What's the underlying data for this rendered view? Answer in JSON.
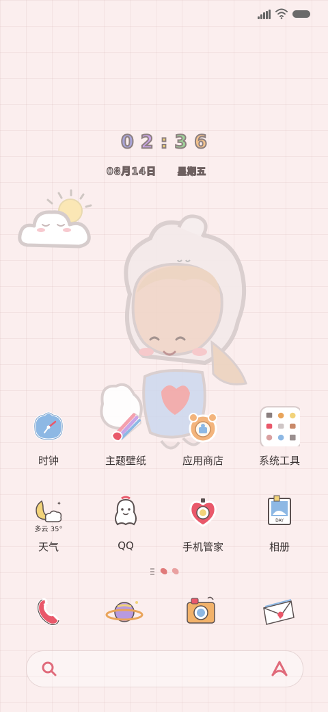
{
  "status_bar": {
    "icons": [
      "signal-icon",
      "wifi-icon",
      "battery-icon"
    ]
  },
  "clock_widget": {
    "digits": [
      {
        "char": "0",
        "color": "#a9a4d8"
      },
      {
        "char": "2",
        "color": "#c9a4e6"
      },
      {
        "char": ":",
        "color": "#f2d37a"
      },
      {
        "char": "3",
        "color": "#9fd49a"
      },
      {
        "char": "6",
        "color": "#f3c28c"
      }
    ],
    "date": "08月14日",
    "weekday": "星期五"
  },
  "apps": [
    {
      "label": "时钟",
      "icon": "clock-icon"
    },
    {
      "label": "主题壁纸",
      "icon": "theme-wallpaper-icon"
    },
    {
      "label": "应用商店",
      "icon": "app-store-icon"
    },
    {
      "label": "系统工具",
      "icon": "system-tools-folder-icon"
    },
    {
      "label": "天气",
      "icon": "weather-icon",
      "icon_text": "多云 35°"
    },
    {
      "label": "QQ",
      "icon": "qq-icon"
    },
    {
      "label": "手机管家",
      "icon": "phone-manager-icon"
    },
    {
      "label": "相册",
      "icon": "gallery-icon",
      "icon_text": "DAY"
    }
  ],
  "page_indicator": {
    "pages": 3,
    "current": 1
  },
  "dock": [
    {
      "icon": "phone-icon"
    },
    {
      "icon": "browser-planet-icon"
    },
    {
      "icon": "camera-icon"
    },
    {
      "icon": "messages-envelope-icon"
    }
  ],
  "search_bar": {
    "left_icon": "search-icon",
    "right_icon": "assistant-icon"
  },
  "colors": {
    "background": "#fbeeee",
    "accent": "#e06a7a"
  }
}
